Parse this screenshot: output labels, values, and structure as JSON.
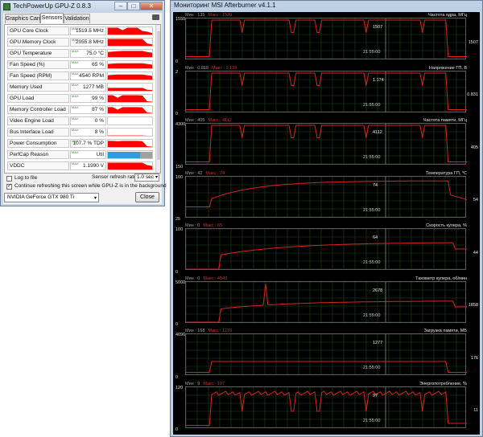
{
  "gpuz": {
    "title": "TechPowerUp GPU-Z 0.8.3",
    "tabs": [
      "Graphics Card",
      "Sensors",
      "Validation"
    ],
    "active_tab": "Sensors",
    "sensors": [
      {
        "name": "GPU Core Clock",
        "value": "1519.5 MHz",
        "max_tag": "MAX"
      },
      {
        "name": "GPU Memory Clock",
        "value": "2055.8 MHz",
        "max_tag": "MAX"
      },
      {
        "name": "GPU Temperature",
        "value": "75.0 °C",
        "max_tag": "MAX"
      },
      {
        "name": "Fan Speed (%)",
        "value": "65 %",
        "max_tag": "MAX"
      },
      {
        "name": "Fan Speed (RPM)",
        "value": "4540 RPM",
        "max_tag": "MAX"
      },
      {
        "name": "Memory Used",
        "value": "1277 MB",
        "max_tag": "MAX"
      },
      {
        "name": "GPU Load",
        "value": "99 %",
        "max_tag": "MAX"
      },
      {
        "name": "Memory Controller Load",
        "value": "87 %",
        "max_tag": "MAX"
      },
      {
        "name": "Video Engine Load",
        "value": "0 %",
        "max_tag": "MAX"
      },
      {
        "name": "Bus Interface Load",
        "value": "8 %",
        "max_tag": "MAX"
      },
      {
        "name": "Power Consumption",
        "value": "107.7 % TDP",
        "max_tag": "MAX"
      },
      {
        "name": "PerfCap Reason",
        "value": "Util",
        "max_tag": "MAX"
      },
      {
        "name": "VDDC",
        "value": "1.1990 V",
        "max_tag": "MAX"
      }
    ],
    "log_to_file_label": "Log to file",
    "log_to_file_checked": false,
    "refresh_rate_label": "Sensor refresh rate:",
    "refresh_rate_value": "1.0 sec",
    "continue_refresh_label": "Continue refreshing this screen while GPU-Z is in the background",
    "continue_refresh_checked": true,
    "gpu_name": "NVIDIA GeForce GTX 980 Ti",
    "close_label": "Close",
    "colors": {
      "graph_fill": "#ff0000",
      "perfcap_blue": "#2f9be0",
      "perfcap_gray": "#a0a0a0"
    }
  },
  "afterburner": {
    "title": "Мониторинг MSI Afterburner v4.1.1",
    "timestamp": "21:55:00",
    "min_prefix": "Мин : ",
    "max_prefix": "Макс : ",
    "panels": [
      {
        "title": "Частота ядра, МГц",
        "min": "135",
        "max": "1520",
        "y_top": "1550",
        "y_bottom": "0",
        "current_center": "1507",
        "current_right": "1507"
      },
      {
        "title": "Напряжение ГП, В",
        "min": "0.818",
        "max": "1.199",
        "y_top": "2",
        "y_bottom": "0",
        "current_center": "1.174",
        "current_right": "0.831"
      },
      {
        "title": "Частота памяти, МГц",
        "min": "405",
        "max": "4112",
        "y_top": "4300",
        "y_bottom": "150",
        "current_center": "4112",
        "current_right": "405"
      },
      {
        "title": "Температура ГП, °С",
        "min": "42",
        "max": "74",
        "y_top": "100",
        "y_bottom": "25",
        "current_center": "74",
        "current_right": "54"
      },
      {
        "title": "Скорость кулера, %",
        "min": "0",
        "max": "65",
        "y_top": "100",
        "y_bottom": "0",
        "current_center": "64",
        "current_right": "44"
      },
      {
        "title": "Тахометр кулера, об/мин",
        "min": "0",
        "max": "4540",
        "y_top": "5000",
        "y_bottom": "0",
        "current_center": "2678",
        "current_right": "1858"
      },
      {
        "title": "Загрузка памяти, МБ",
        "min": "168",
        "max": "1278",
        "y_top": "4096",
        "y_bottom": "0",
        "current_center": "1277",
        "current_right": "176"
      },
      {
        "title": "Энергопотребление, %",
        "min": "9",
        "max": "107",
        "y_top": "120",
        "y_bottom": "0",
        "current_center": "97",
        "current_right": "11"
      }
    ],
    "colors": {
      "background": "#000000",
      "grid": "#1e4a1e",
      "line": "#e0201c"
    }
  }
}
